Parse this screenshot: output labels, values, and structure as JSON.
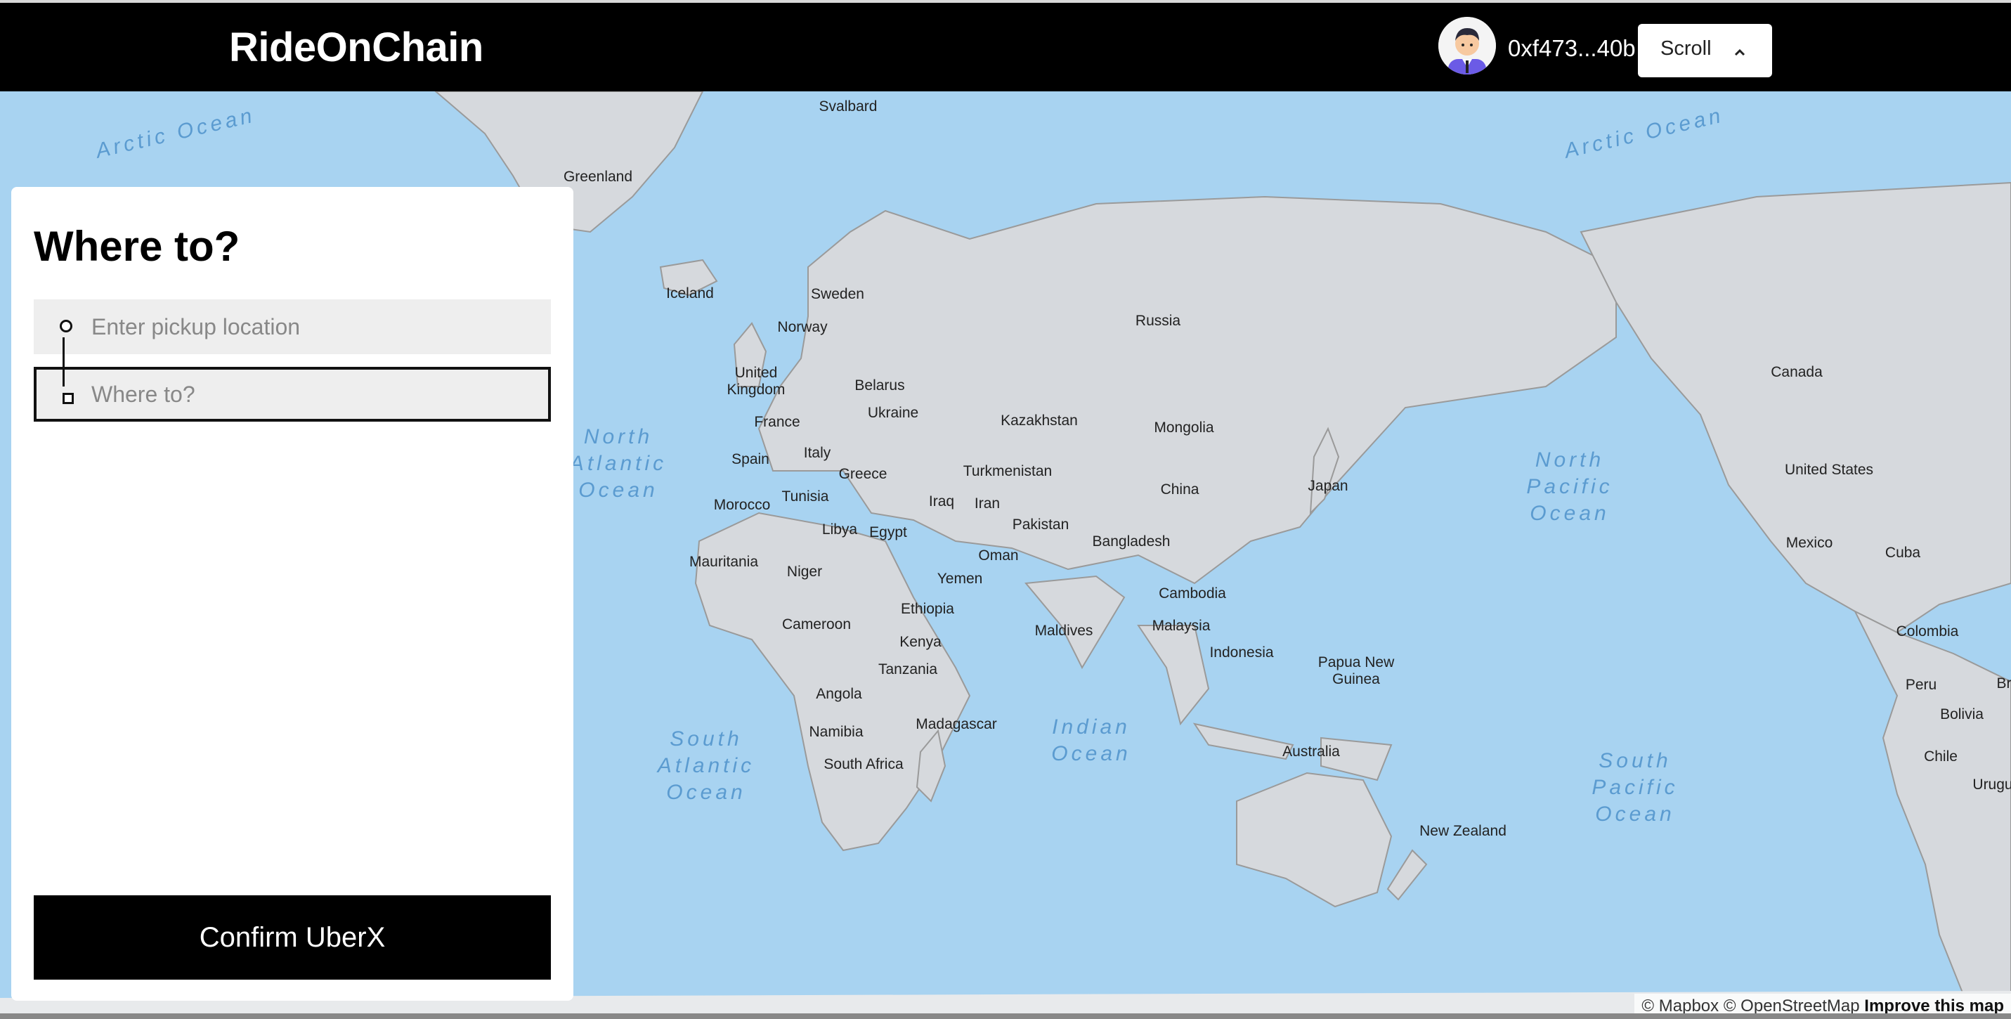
{
  "header": {
    "brand": "RideOnChain",
    "wallet_address": "0xf473...40b",
    "network_button_label": "Scroll"
  },
  "booking_panel": {
    "title": "Where to?",
    "pickup_placeholder": "Enter pickup location",
    "dropoff_placeholder": "Where to?",
    "confirm_label": "Confirm UberX"
  },
  "map": {
    "attribution": "© Mapbox © OpenStreetMap",
    "improve_link": "Improve this map",
    "ocean_labels": {
      "arctic_left": "Arctic Ocean",
      "arctic_right": "Arctic Ocean",
      "north_atlantic": [
        "North",
        "Atlantic",
        "Ocean"
      ],
      "north_pacific": [
        "North",
        "Pacific",
        "Ocean"
      ],
      "south_atlantic": [
        "South",
        "Atlantic",
        "Ocean"
      ],
      "indian": [
        "Indian",
        "Ocean"
      ],
      "south_pacific": [
        "South",
        "Pacific",
        "Ocean"
      ]
    },
    "place_labels": {
      "svalbard": "Svalbard",
      "greenland": "Greenland",
      "iceland": "Iceland",
      "sweden": "Sweden",
      "norway": "Norway",
      "russia": "Russia",
      "canada": "Canada",
      "united_kingdom": "United Kingdom",
      "belarus": "Belarus",
      "ukraine": "Ukraine",
      "kazakhstan": "Kazakhstan",
      "mongolia": "Mongolia",
      "france": "France",
      "spain": "Spain",
      "italy": "Italy",
      "greece": "Greece",
      "turkmenistan": "Turkmenistan",
      "china": "China",
      "japan": "Japan",
      "united_states": "United States",
      "morocco": "Morocco",
      "tunisia": "Tunisia",
      "iraq": "Iraq",
      "iran": "Iran",
      "libya": "Libya",
      "egypt": "Egypt",
      "pakistan": "Pakistan",
      "bangladesh": "Bangladesh",
      "oman": "Oman",
      "mexico": "Mexico",
      "cuba": "Cuba",
      "mauritania": "Mauritania",
      "niger": "Niger",
      "yemen": "Yemen",
      "ethiopia": "Ethiopia",
      "cambodia": "Cambodia",
      "colombia": "Colombia",
      "cameroon": "Cameroon",
      "maldives": "Maldives",
      "malaysia": "Malaysia",
      "kenya": "Kenya",
      "indonesia": "Indonesia",
      "papua_new_guinea": [
        "Papua New",
        "Guinea"
      ],
      "tanzania": "Tanzania",
      "peru": "Peru",
      "angola": "Angola",
      "bolivia": "Bolivia",
      "madagascar": "Madagascar",
      "namibia": "Namibia",
      "australia": "Australia",
      "chile": "Chile",
      "south_africa": "South Africa",
      "urugu": "Urugu",
      "new_zealand": "New Zealand",
      "br": "Br"
    }
  }
}
